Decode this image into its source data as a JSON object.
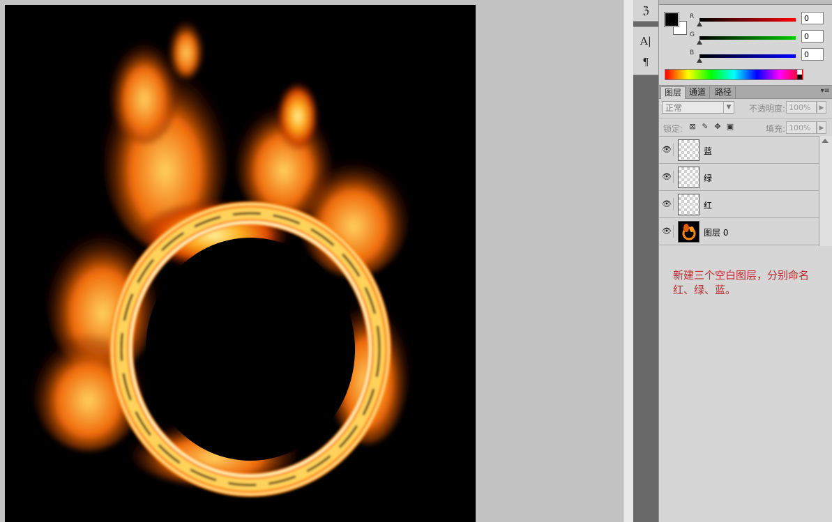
{
  "toolstrip": {
    "tools": [
      {
        "icon": "history-brush-icon",
        "glyph": "ℨ"
      },
      {
        "icon": "character-panel-icon",
        "glyph": "A|"
      },
      {
        "icon": "paragraph-panel-icon",
        "glyph": "¶"
      }
    ]
  },
  "color_panel": {
    "foreground": "#000000",
    "background": "#ffffff",
    "channels": [
      {
        "label": "R",
        "value": "0",
        "color": "#ff0000"
      },
      {
        "label": "G",
        "value": "0",
        "color": "#00cc00"
      },
      {
        "label": "B",
        "value": "0",
        "color": "#0000ff"
      }
    ]
  },
  "layers_panel": {
    "tabs": [
      {
        "label": "图层",
        "active": true
      },
      {
        "label": "通道",
        "active": false
      },
      {
        "label": "路径",
        "active": false
      }
    ],
    "menu_glyph": "▾≡",
    "blend_mode": "正常",
    "opacity_label": "不透明度:",
    "opacity_value": "100%",
    "lock_label": "锁定:",
    "fill_label": "填充:",
    "fill_value": "100%",
    "layers": [
      {
        "name": "蓝",
        "thumb": "transparent"
      },
      {
        "name": "绿",
        "thumb": "transparent"
      },
      {
        "name": "红",
        "thumb": "transparent"
      },
      {
        "name": "图层 0",
        "thumb": "fire"
      }
    ]
  },
  "note": "新建三个空白图层，分别命名红、绿、蓝。",
  "accent_note_color": "#c0272d"
}
